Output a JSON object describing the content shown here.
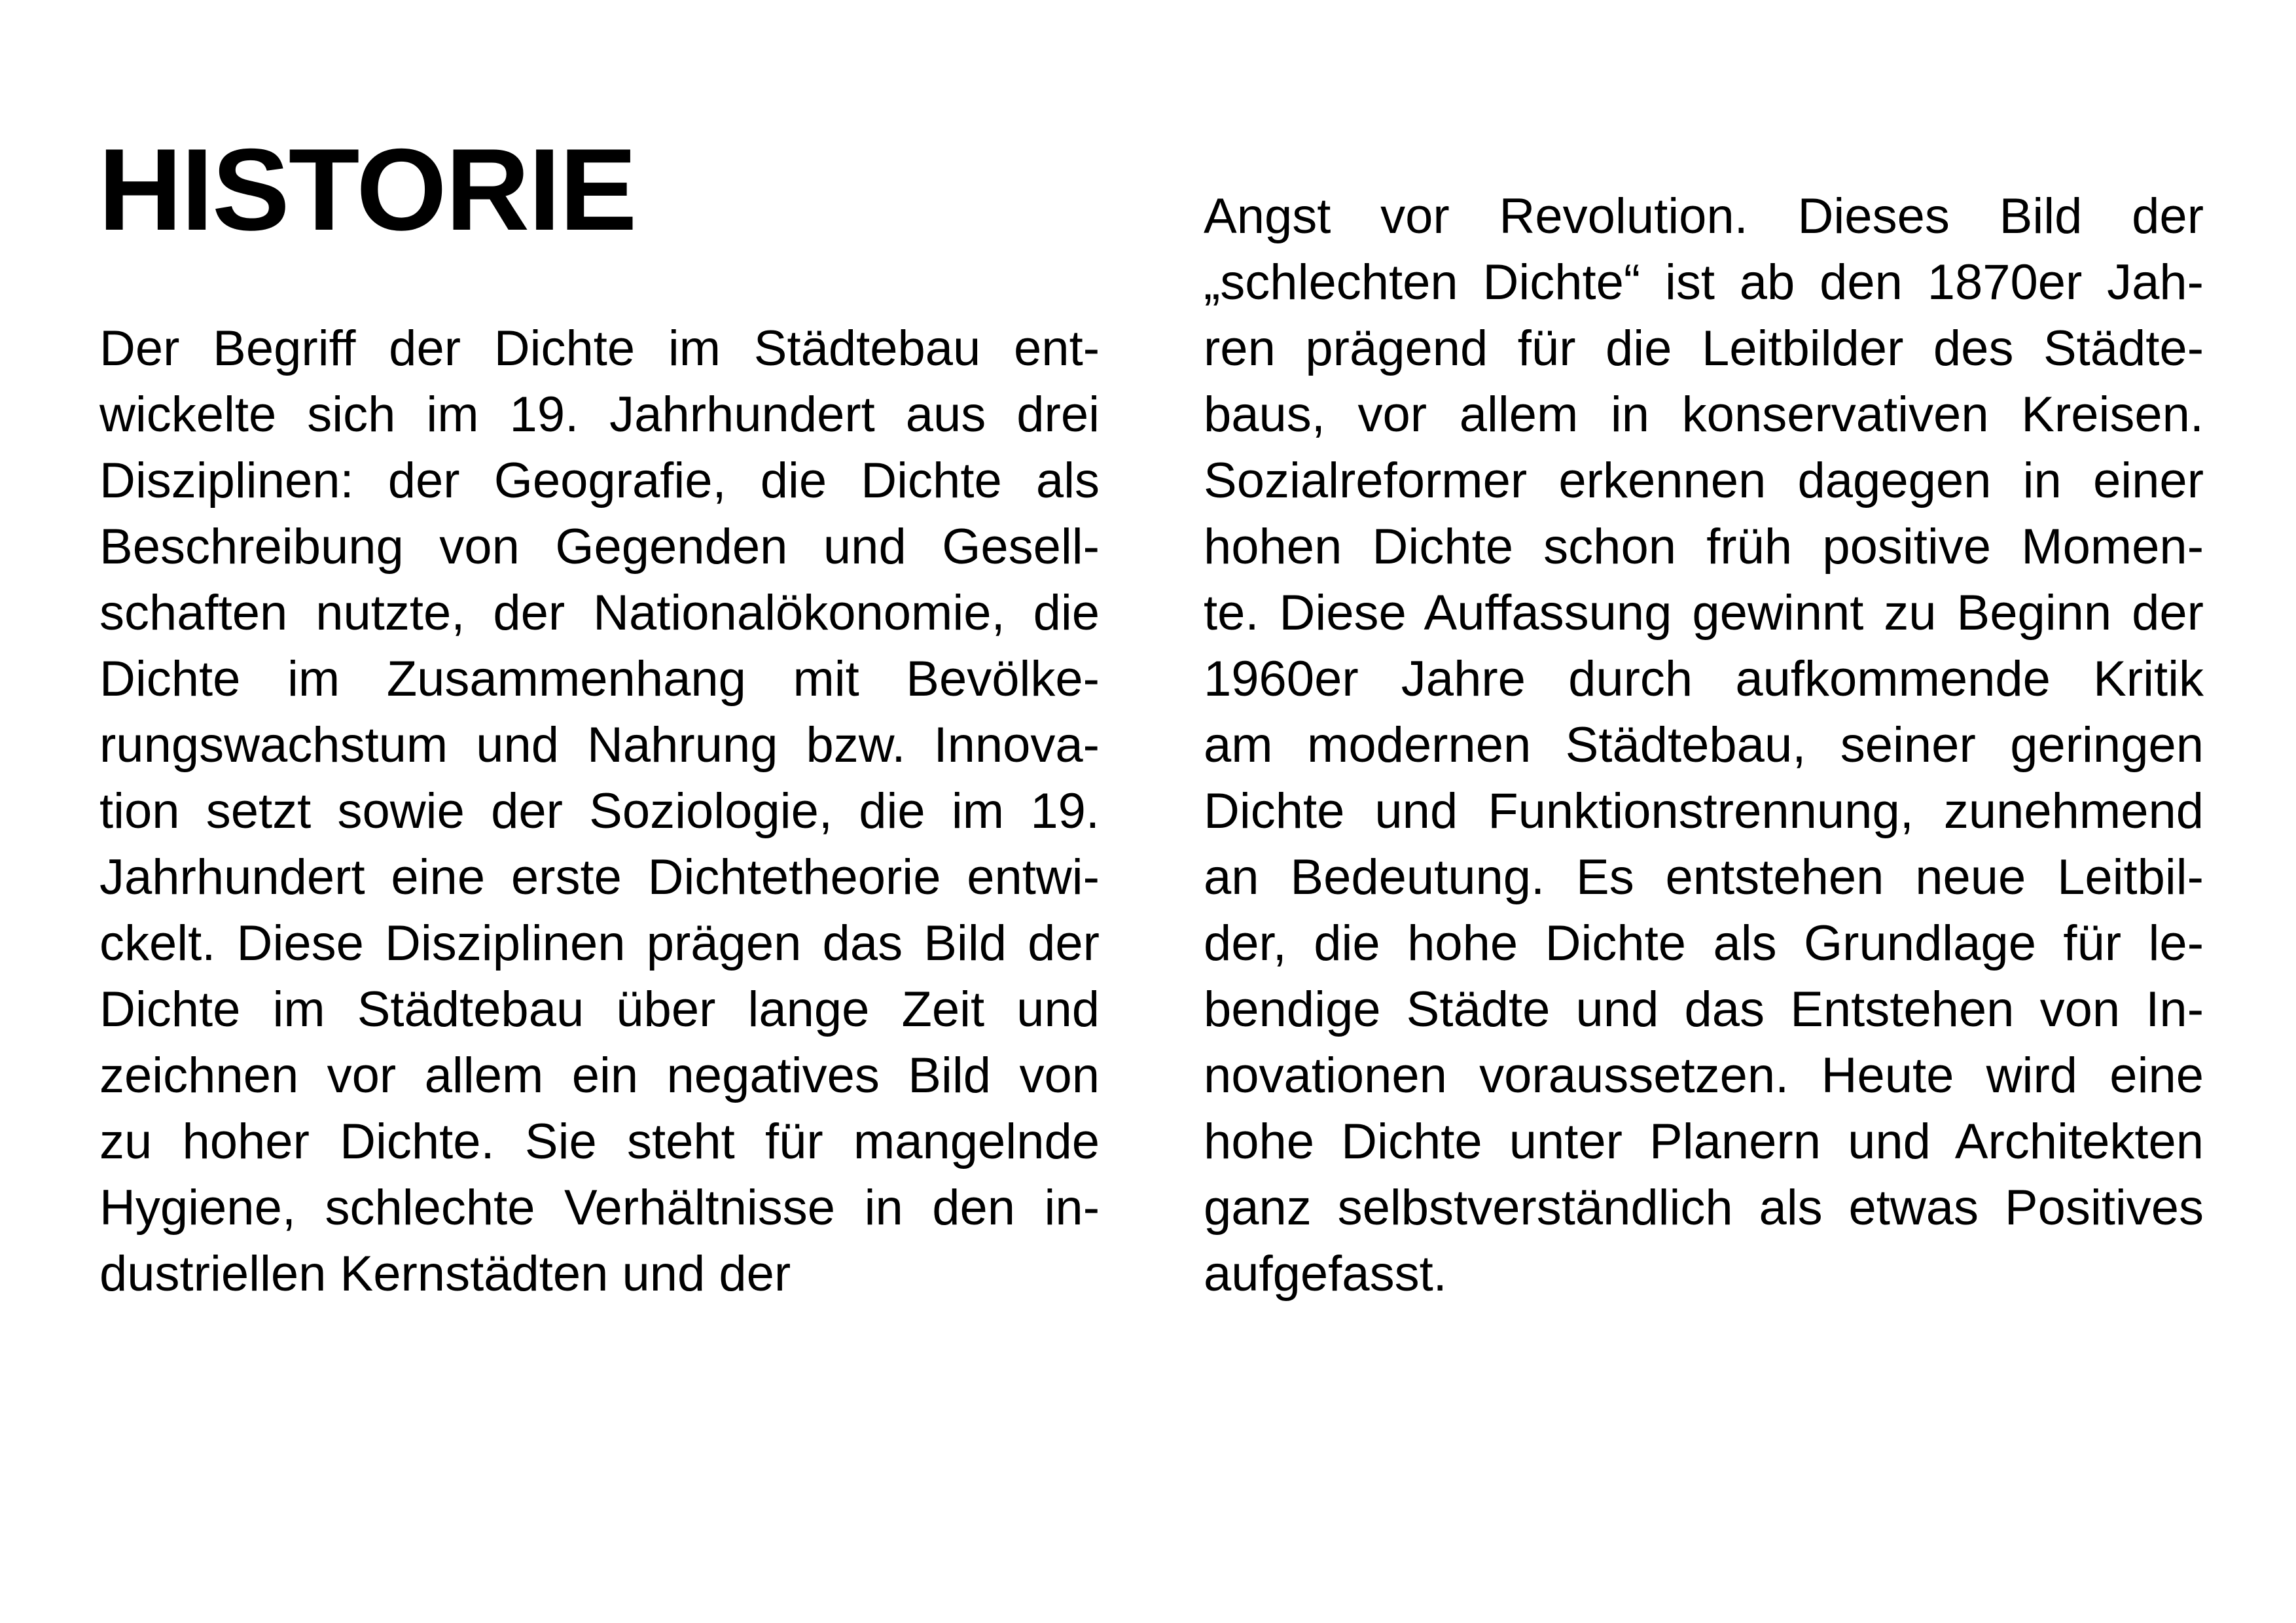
{
  "title": "HISTORIE",
  "left_column": [
    "Der Begriff der Dichte im Städtebau ent-",
    "wickelte sich im 19. Jahrhundert aus drei",
    "Disziplinen: der Geografie, die Dichte als",
    "Beschreibung von Gegenden und Gesell-",
    "schaften nutzte, der Nationalökonomie, die",
    "Dichte im Zusammenhang mit Bevölke-",
    "rungswachstum und Nahrung bzw. Innova-",
    "tion setzt sowie der Soziologie, die im 19.",
    "Jahrhundert eine erste Dichtetheorie entwi-",
    "ckelt. Diese Disziplinen prägen das Bild der",
    "Dichte im Städtebau über lange Zeit und",
    "zeichnen vor allem ein negatives Bild von",
    "zu hoher Dichte. Sie steht für mangelnde",
    "Hygiene, schlechte Verhältnisse in den in-",
    "dustriellen Kernstädten und der"
  ],
  "right_column": [
    "Angst vor Revolution. Dieses Bild der",
    "„schlechten Dichte“ ist ab den 1870er Jah-",
    "ren prägend für die Leitbilder des Städte-",
    "baus, vor allem in konservativen Kreisen.",
    "Sozialreformer erkennen dagegen in einer",
    "hohen Dichte schon früh positive Momen-",
    "te. Diese Auffassung gewinnt zu Beginn der",
    "1960er Jahre durch aufkommende Kritik",
    "am modernen Städtebau, seiner geringen",
    "Dichte und Funktionstrennung, zunehmend",
    "an Bedeutung. Es entstehen neue Leitbil-",
    "der, die hohe Dichte als Grundlage für le-",
    "bendige Städte und das Entstehen von In-",
    "novationen voraussetzen. Heute wird eine",
    "hohe Dichte unter Planern und Architekten",
    "ganz selbstverständlich als etwas Positives",
    "aufgefasst."
  ]
}
